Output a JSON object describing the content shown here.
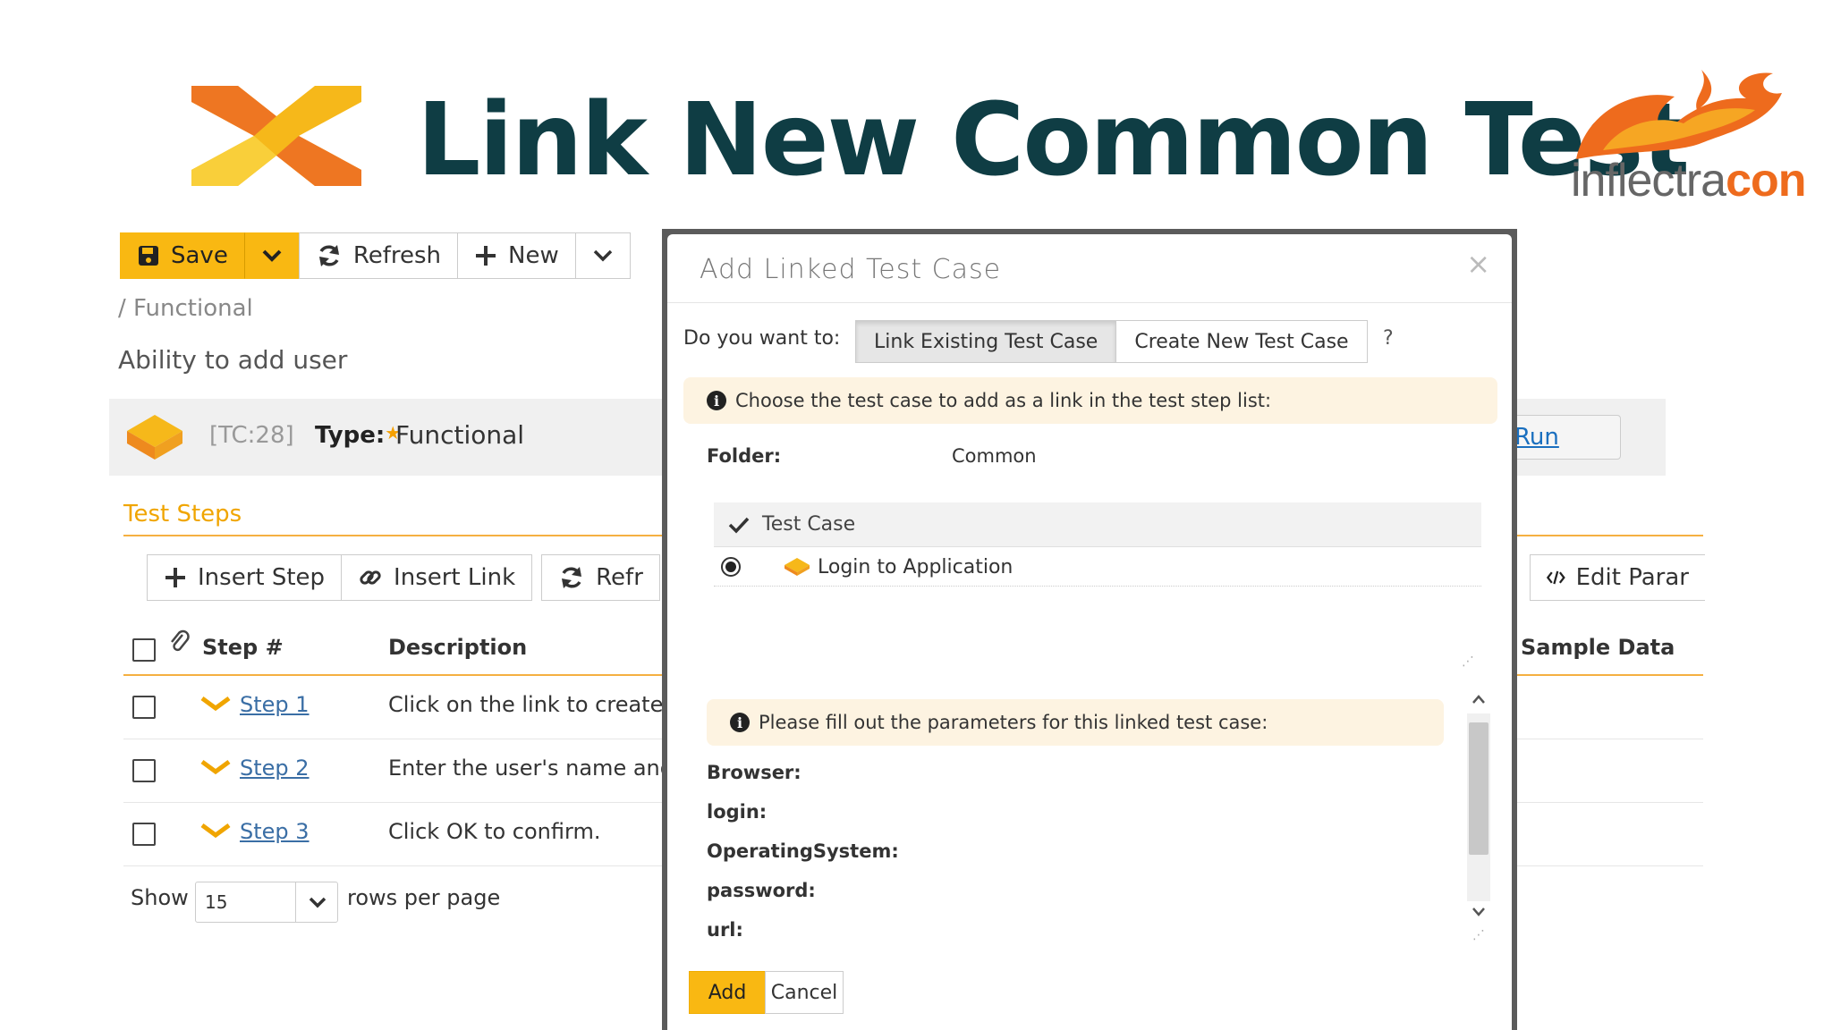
{
  "slide": {
    "title": "Link New Common Test",
    "brand_prefix": "inflectra",
    "brand_suffix": "con"
  },
  "toolbar": {
    "save_label": "Save",
    "refresh_label": "Refresh",
    "new_label": "New"
  },
  "breadcrumb": "/ Functional",
  "test_case": {
    "name": "Ability to add user",
    "id": "[TC:28]",
    "type_label": "Type:",
    "type_value": "Functional",
    "run_label": "Run"
  },
  "steps": {
    "header": "Test Steps",
    "insert_step": "Insert Step",
    "insert_link": "Insert Link",
    "refresh": "Refr",
    "edit_params": "Edit Parar",
    "columns": {
      "step": "Step #",
      "description": "Description",
      "sample": "Sample Data"
    },
    "rows": [
      {
        "step": "Step 1",
        "description": "Click on the link to create"
      },
      {
        "step": "Step 2",
        "description": "Enter the user's name and"
      },
      {
        "step": "Step 3",
        "description": "Click OK to confirm."
      }
    ],
    "show_label": "Show",
    "rows_value": "15",
    "rows_label": "rows per page"
  },
  "modal": {
    "title": "Add Linked Test Case",
    "close": "×",
    "question": "Do you want to:",
    "option_link": "Link Existing Test Case",
    "option_create": "Create New Test Case",
    "help": "?",
    "info1": "Choose the test case to add as a link in the test step list:",
    "folder_label": "Folder:",
    "folder_value": "Common",
    "table_header": "Test Case",
    "table_rows": [
      {
        "name": "Login to Application"
      }
    ],
    "info2": "Please fill out the parameters for this linked test case:",
    "params": [
      "Browser:",
      "login:",
      "OperatingSystem:",
      "password:",
      "url:"
    ],
    "add_label": "Add",
    "cancel_label": "Cancel"
  },
  "colors": {
    "accent": "#f9b812",
    "title": "#0f3d44",
    "link": "#3a6ea5",
    "note_bg": "#fdf3e1"
  }
}
